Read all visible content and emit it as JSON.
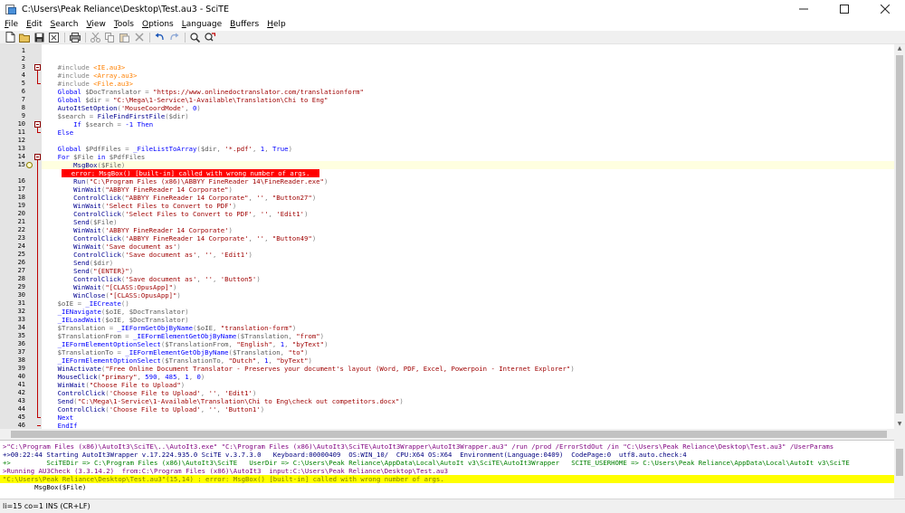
{
  "window": {
    "title": "C:\\Users\\Peak Reliance\\Desktop\\Test.au3 - SciTE",
    "controls": [
      "minimize",
      "maximize",
      "close"
    ]
  },
  "menu": [
    "File",
    "Edit",
    "Search",
    "View",
    "Tools",
    "Options",
    "Language",
    "Buffers",
    "Help"
  ],
  "menu_accel": [
    "F",
    "E",
    "S",
    "V",
    "T",
    "O",
    "L",
    "B",
    "H"
  ],
  "toolbar": {
    "icons": [
      "new-icon",
      "open-icon",
      "save-icon",
      "close-icon",
      "print-icon",
      "cut-icon",
      "copy-icon",
      "paste-icon",
      "delete-icon",
      "undo-icon",
      "redo-icon",
      "find-icon",
      "replace-icon"
    ]
  },
  "editor": {
    "current_line": 15,
    "error_annotation": "error: MsgBox() [built-in] called with wrong number of args.",
    "lines": [
      {
        "n": "1",
        "text": ""
      },
      {
        "n": "2",
        "text": ""
      },
      {
        "n": "3",
        "text": "#include <IE.au3>"
      },
      {
        "n": "4",
        "text": "#include <Array.au3>"
      },
      {
        "n": "5",
        "text": "#include <File.au3>"
      },
      {
        "n": "6",
        "text": "Global $DocTranslator = \"https://www.onlinedoctranslator.com/translationform\""
      },
      {
        "n": "7",
        "text": "Global $dir = \"C:\\Mega\\1-Service\\1-Available\\Translation\\Chi to Eng\""
      },
      {
        "n": "8",
        "text": "AutoItSetOption('MouseCoordMode', 0)"
      },
      {
        "n": "9",
        "text": "$search = FileFindFirstFile($dir)"
      },
      {
        "n": "10",
        "text": "    If $search = -1 Then"
      },
      {
        "n": "11",
        "text": "Else"
      },
      {
        "n": "12",
        "text": ""
      },
      {
        "n": "13",
        "text": "Global $PdfFiles = _FileListToArray($dir, '*.pdf', 1, True)"
      },
      {
        "n": "14",
        "text": "For $File in $PdfFiles"
      },
      {
        "n": "15",
        "text": "    MsgBox($File)"
      },
      {
        "n": "16",
        "text": "    Run(\"C:\\Program Files (x86)\\ABBYY FineReader 14\\FineReader.exe\")"
      },
      {
        "n": "17",
        "text": "    WinWait(\"ABBYY FineReader 14 Corporate\")"
      },
      {
        "n": "18",
        "text": "    ControlClick(\"ABBYY FineReader 14 Corporate\", '', \"Button27\")"
      },
      {
        "n": "19",
        "text": "    WinWait('Select Files to Convert to PDF')"
      },
      {
        "n": "20",
        "text": "    ControlClick('Select Files to Convert to PDF', '', 'Edit1')"
      },
      {
        "n": "21",
        "text": "    Send($File)"
      },
      {
        "n": "22",
        "text": "    WinWait('ABBYY FineReader 14 Corporate')"
      },
      {
        "n": "23",
        "text": "    ControlClick('ABBYY FineReader 14 Corporate', '', \"Button49\")"
      },
      {
        "n": "24",
        "text": "    WinWait('Save document as')"
      },
      {
        "n": "25",
        "text": "    ControlClick('Save document as', '', 'Edit1')"
      },
      {
        "n": "26",
        "text": "    Send($dir)"
      },
      {
        "n": "27",
        "text": "    Send(\"{ENTER}\")"
      },
      {
        "n": "28",
        "text": "    ControlClick('Save document as', '', 'Button5')"
      },
      {
        "n": "29",
        "text": "    WinWait(\"[CLASS:OpusApp]\")"
      },
      {
        "n": "30",
        "text": "    WinClose(\"[CLASS:OpusApp]\")"
      },
      {
        "n": "31",
        "text": "$oIE = _IECreate()"
      },
      {
        "n": "32",
        "text": "_IENavigate($oIE, $DocTranslator)"
      },
      {
        "n": "33",
        "text": "_IELoadWait($oIE, $DocTranslator)"
      },
      {
        "n": "34",
        "text": "$Translation = _IEFormGetObjByName($oIE, \"translation-form\")"
      },
      {
        "n": "35",
        "text": "$TranslationFrom = _IEFormElementGetObjByName($Translation, \"from\")"
      },
      {
        "n": "36",
        "text": "_IEFormElementOptionSelect($TranslationFrom, \"English\", 1, \"byText\")"
      },
      {
        "n": "37",
        "text": "$TranslationTo = _IEFormElementGetObjByName($Translation, \"to\")"
      },
      {
        "n": "38",
        "text": "_IEFormElementOptionSelect($TranslationTo, \"Dutch\", 1, \"byText\")"
      },
      {
        "n": "39",
        "text": "WinActivate(\"Free Online Document Translator - Preserves your document's layout (Word, PDF, Excel, Powerpoin - Internet Explorer\")"
      },
      {
        "n": "40",
        "text": "MouseClick(\"primary\", 590, 485, 1, 0)"
      },
      {
        "n": "41",
        "text": "WinWait(\"Choose File to Upload\")"
      },
      {
        "n": "42",
        "text": "ControlClick('Choose File to Upload', '', 'Edit1')"
      },
      {
        "n": "43",
        "text": "Send(\"C:\\Mega\\1-Service\\1-Available\\Translation\\Chi to Eng\\check out competitors.docx\")"
      },
      {
        "n": "44",
        "text": "ControlClick('Choose File to Upload', '', 'Button1')"
      },
      {
        "n": "45",
        "text": "Next"
      },
      {
        "n": "46",
        "text": "EndIf"
      }
    ]
  },
  "output": {
    "lines": [
      {
        "style": "o-cmd",
        "text": ">\"C:\\Program Files (x86)\\AutoIt3\\SciTE\\..\\AutoIt3.exe\" \"C:\\Program Files (x86)\\AutoIt3\\SciTE\\AutoIt3Wrapper\\AutoIt3Wrapper.au3\" /run /prod /ErrorStdOut /in \"C:\\Users\\Peak Reliance\\Desktop\\Test.au3\" /UserParams"
      },
      {
        "style": "o-blue",
        "text": "+>00:22:44 Starting AutoIt3Wrapper v.17.224.935.0 SciTE v.3.7.3.0   Keyboard:00000409  OS:WIN_10/  CPU:X64 OS:X64  Environment(Language:0409)  CodePage:0  utf8.auto.check:4"
      },
      {
        "style": "o-green",
        "text": "+>         SciTEDir => C:\\Program Files (x86)\\AutoIt3\\SciTE   UserDir => C:\\Users\\Peak Reliance\\AppData\\Local\\AutoIt v3\\SciTE\\AutoIt3Wrapper   SCITE_USERHOME => C:\\Users\\Peak Reliance\\AppData\\Local\\AutoIt v3\\SciTE"
      },
      {
        "style": "o-cmd",
        "text": ">Running AU3Check (3.3.14.2)  from:C:\\Program Files (x86)\\AutoIt3  input:C:\\Users\\Peak Reliance\\Desktop\\Test.au3"
      },
      {
        "style": "o-err",
        "text": "\"C:\\Users\\Peak Reliance\\Desktop\\Test.au3\"(15,14) : error: MsgBox() [built-in] called with wrong number of args."
      },
      {
        "style": "o-plain",
        "text": "        MsgBox($File)"
      }
    ]
  },
  "status": "li=15 co=1 INS (CR+LF)"
}
